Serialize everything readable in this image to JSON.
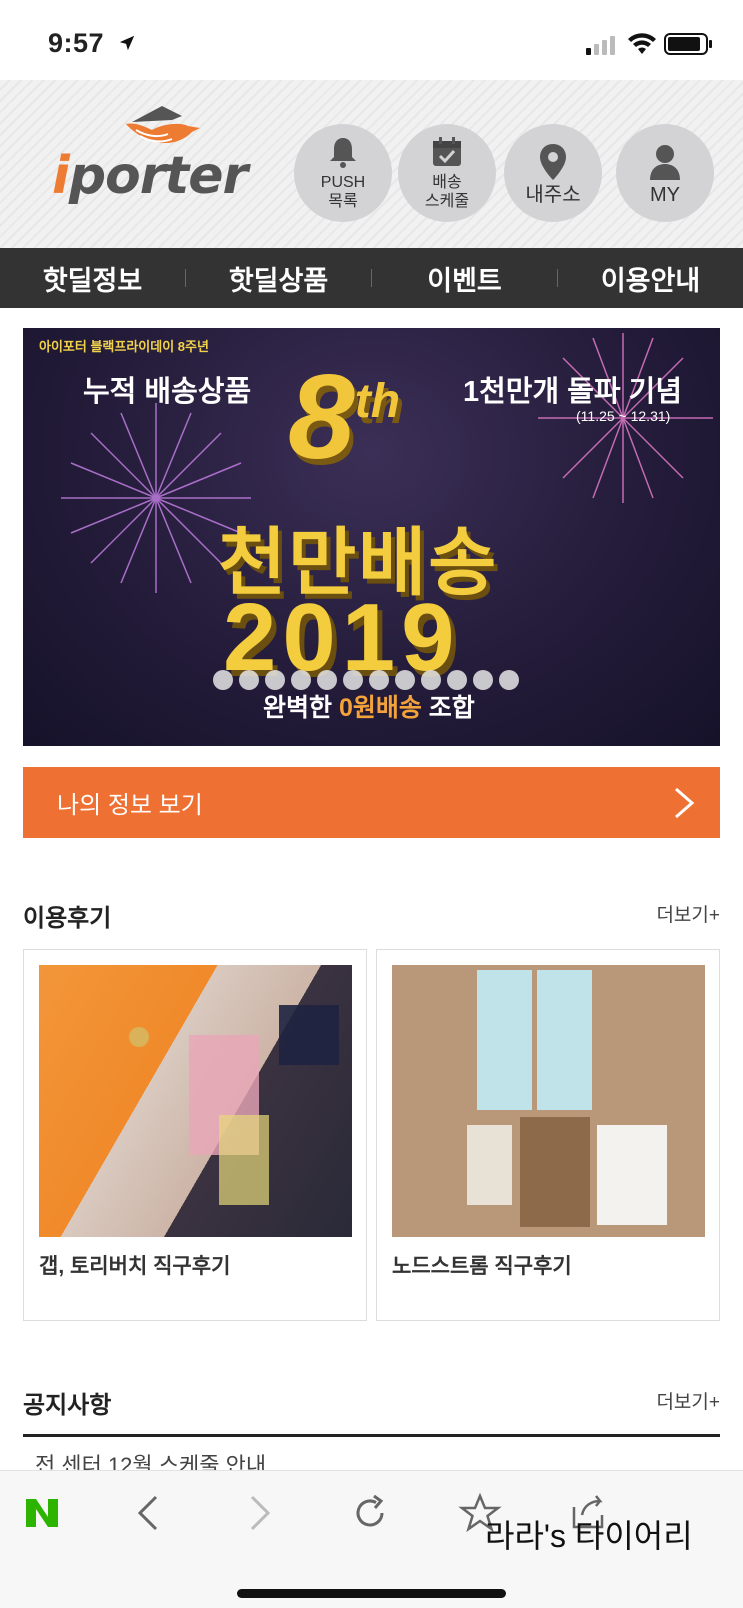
{
  "status_bar": {
    "time": "9:57"
  },
  "header": {
    "logo": "iporter",
    "buttons": [
      {
        "label": "PUSH\n목록",
        "icon": "bell-icon"
      },
      {
        "label": "배송\n스케줄",
        "icon": "calendar-icon"
      },
      {
        "label": "내주소",
        "icon": "location-pin-icon"
      },
      {
        "label": "MY",
        "icon": "person-icon"
      }
    ]
  },
  "nav": {
    "items": [
      "핫딜정보",
      "핫딜상품",
      "이벤트",
      "이용안내"
    ]
  },
  "banner": {
    "top_tag": "아이포터 블랙프라이데이 8주년",
    "left_text": "누적 배송상품",
    "right_text": "1천만개 돌파 기념",
    "date_range": "(11.25 ~ 12.31)",
    "big_number": "8",
    "big_suffix": "th",
    "main_text": "천만배송",
    "year": "2019",
    "bottom_pre": "완벽한 ",
    "bottom_highlight": "0원배송",
    "bottom_post": " 조합",
    "slide_count": 12
  },
  "my_info": {
    "label": "나의 정보 보기"
  },
  "reviews": {
    "title": "이용후기",
    "more": "더보기+",
    "items": [
      {
        "caption": "갭, 토리버치 직구후기"
      },
      {
        "caption": "노드스트롬 직구후기"
      }
    ]
  },
  "notices": {
    "title": "공지사항",
    "more": "더보기+",
    "items": [
      "전 센터 12월 스케줄 안내"
    ]
  },
  "toolbar": {
    "watermark": "라라's 타이어리"
  },
  "colors": {
    "accent": "#ee7032",
    "nav_bg": "#333333",
    "naver_green": "#2db400"
  }
}
